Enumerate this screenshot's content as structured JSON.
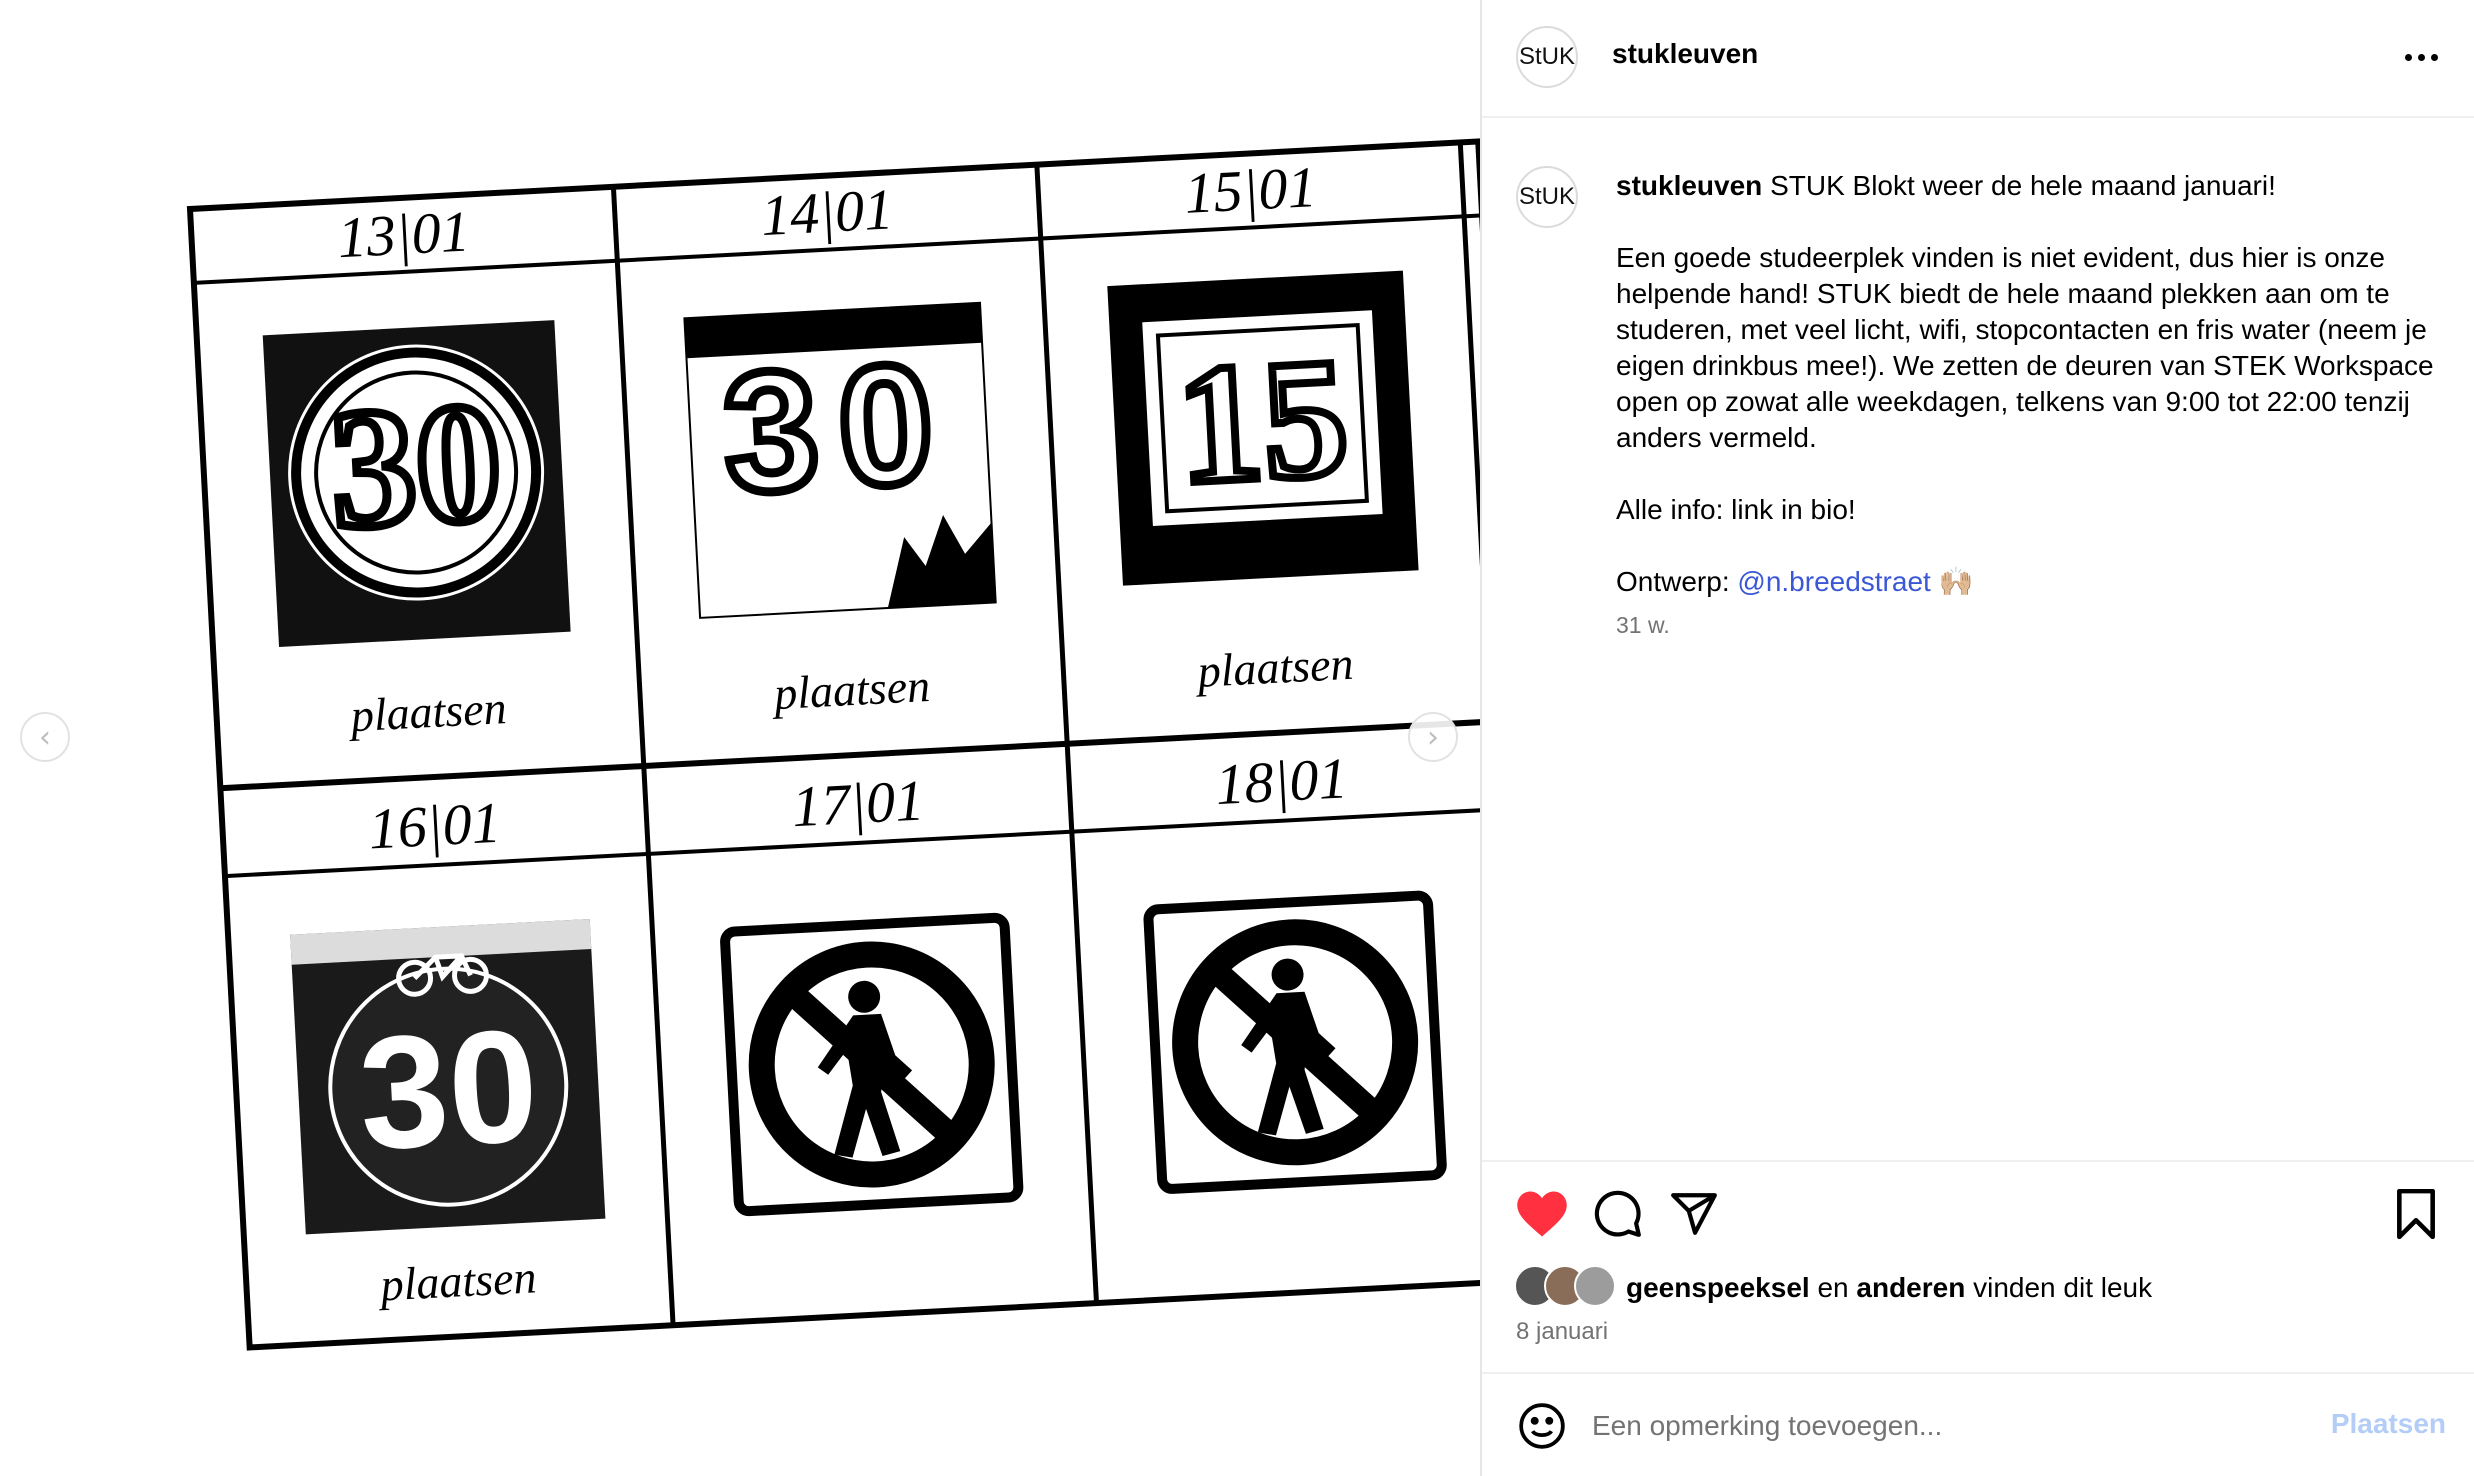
{
  "post": {
    "username": "stukleuven",
    "avatar_text": "StUK",
    "caption_user": "stukleuven",
    "caption_first": "STUK Blokt weer de hele maand januari!",
    "caption_para2": "Een goede studeerplek vinden is niet evident, dus hier is onze helpende hand! STUK biedt de hele maand plekken aan om te studeren, met veel licht, wifi, stopcontacten en fris water (neem je eigen drinkbus mee!). We zetten de deuren van STEK Workspace open op zowat alle weekdagen, telkens van 9:00 tot 22:00 tenzij anders vermeld.",
    "caption_para3": "Alle info: link in bio!",
    "caption_design_label": "Ontwerp:",
    "caption_mention": "@n.breedstraet",
    "caption_emoji": "🙌🏼",
    "age": "31 w.",
    "likes_user": "geenspeeksel",
    "likes_connector": "en",
    "likes_others": "anderen",
    "likes_suffix": "vinden dit leuk",
    "date": "8 januari"
  },
  "comment": {
    "placeholder": "Een opmerking toevoegen...",
    "post_label": "Plaatsen"
  },
  "media": {
    "cells": [
      {
        "date": "13|01",
        "label": "plaatsen",
        "picture": "speed-30-ring-sign"
      },
      {
        "date": "14|01",
        "label": "plaatsen",
        "picture": "number-30-balloons"
      },
      {
        "date": "15|01",
        "label": "plaatsen",
        "picture": "number-15-plaque"
      },
      {
        "date": "16|01",
        "label": "plaatsen",
        "picture": "speed-30-road-marking"
      },
      {
        "date": "17|01",
        "label": "",
        "picture": "no-pedestrians-sign"
      },
      {
        "date": "18|01",
        "label": "",
        "picture": "no-pedestrians-sign"
      }
    ],
    "prev_icon": "chevron-left-icon",
    "next_icon": "chevron-right-icon"
  },
  "colors": {
    "like_red": "#ff3040",
    "link_blue": "#3a57d6",
    "post_button_disabled": "#b3cdf7",
    "muted_text": "#737373"
  }
}
